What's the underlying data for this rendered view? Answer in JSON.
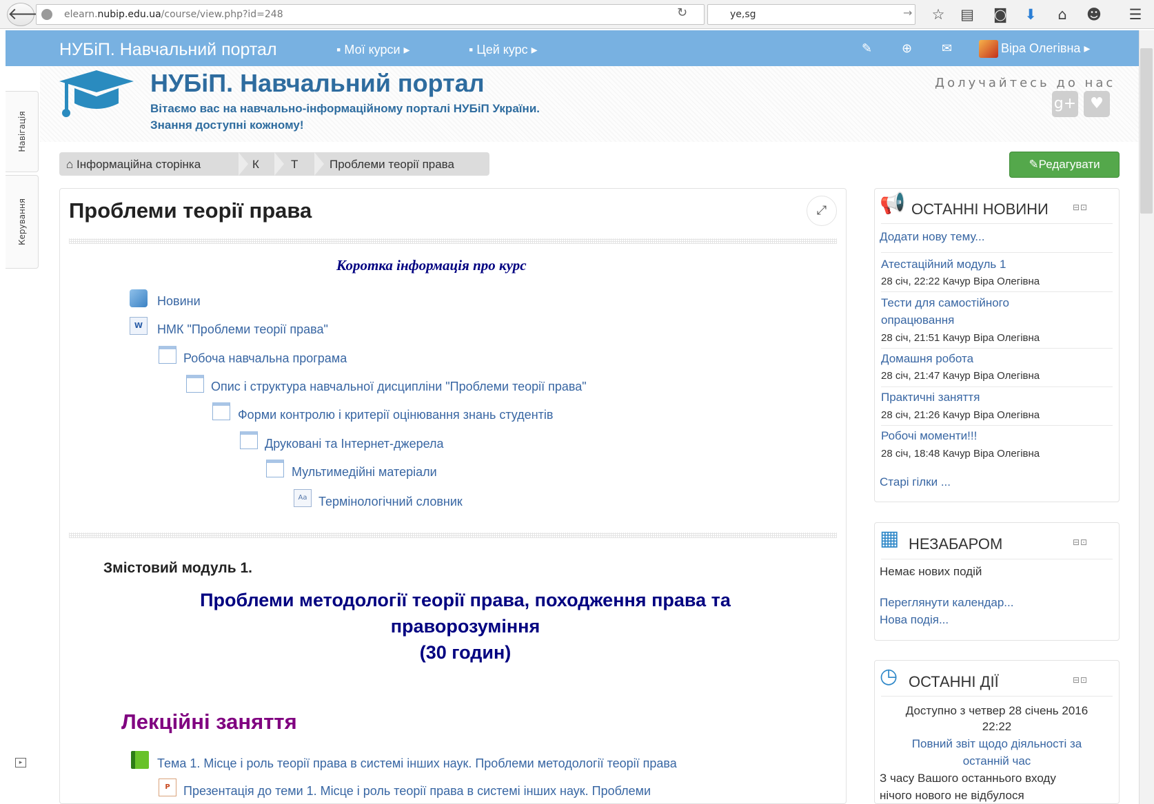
{
  "browser": {
    "url_prefix": "elearn.",
    "url_host": "nubip.edu.ua",
    "url_path": "/course/view.php?id=248",
    "search_value": "ye,sg",
    "reload_icon": "↻",
    "search_go": "→"
  },
  "navbar": {
    "brand": "НУБіП. Навчальний портал",
    "my_courses": "Мої курси",
    "this_course": "Цей курс",
    "user_name": "Віра Олегівна"
  },
  "drawers": {
    "navigation": "Навігація",
    "administration": "Керування"
  },
  "header": {
    "site_name": "НУБіП. Навчальний портал",
    "welcome_line1": "Вітаємо вас на навчально-інформаційному порталі НУБіП України.",
    "welcome_line2": "Знання доступні кожному!",
    "join_us": "Долучайтесь до нас"
  },
  "breadcrumb": {
    "home": "Інформаційна сторінка",
    "k": "К",
    "t": "Т",
    "current": "Проблеми теорії права"
  },
  "edit_button": "Редагувати",
  "course": {
    "title": "Проблеми теорії права",
    "brief_info": "Коротка інформація про курс",
    "activities": [
      {
        "label": "Новини",
        "icon": "forum-icon"
      },
      {
        "label": "НМК \"Проблеми теорії права\"",
        "icon": "word-file-icon"
      },
      {
        "label": "Робоча навчальна програма",
        "icon": "page-icon"
      },
      {
        "label": "Опис і структура навчальної дисципліни \"Проблеми теорії права\"",
        "icon": "page-icon"
      },
      {
        "label": "Форми контролю і критерії оцінювання знань студентів",
        "icon": "page-icon"
      },
      {
        "label": "Друковані та Інтернет-джерела",
        "icon": "page-icon"
      },
      {
        "label": "Мультимедійні матеріали",
        "icon": "page-icon"
      },
      {
        "label": "Термінологічний словник",
        "icon": "glossary-icon"
      }
    ],
    "module_label": "Змістовий модуль 1.",
    "module_title_line1": "Проблеми методології теорії права, походження права та",
    "module_title_line2": "праворозуміння",
    "module_title_line3": "(30 годин)",
    "lectures_heading": "Лекційні заняття",
    "topic1": "Тема 1. Місце і роль теорії права в системі інших наук. Проблеми методології теорії права",
    "topic1_presentation": "Презентація до теми 1. Місце і роль теорії права в системі інших наук. Проблеми"
  },
  "news_block": {
    "title": "ОСТАННІ НОВИНИ",
    "add_topic": "Додати нову тему...",
    "items": [
      {
        "title": "Атестаційний модуль 1",
        "meta": "28 січ, 22:22 Качур Віра Олегівна"
      },
      {
        "title_line1": "Тести для самостійного",
        "title_line2": "опрацювання",
        "meta": "28 січ, 21:51 Качур Віра Олегівна"
      },
      {
        "title": "Домашня робота",
        "meta": "28 січ, 21:47 Качур Віра Олегівна"
      },
      {
        "title": "Практичні заняття",
        "meta": "28 січ, 21:26 Качур Віра Олегівна"
      },
      {
        "title": "Робочі моменти!!!",
        "meta": "28 січ, 18:48 Качур Віра Олегівна"
      }
    ],
    "older": "Старі гілки ..."
  },
  "upcoming_block": {
    "title": "НЕЗАБАРОМ",
    "no_events": "Немає нових подій",
    "go_calendar": "Переглянути календар...",
    "new_event": "Нова подія..."
  },
  "recent_block": {
    "title": "ОСТАННІ ДІЇ",
    "since_line1": "Доступно з четвер 28 січень 2016",
    "since_line2": "22:22",
    "full_report_line1": "Повний звіт щодо діяльності за",
    "full_report_line2": "останній час",
    "nothing_line1": "З часу Вашого останнього входу",
    "nothing_line2": "нічого нового не відбулося"
  },
  "colors": {
    "navbar": "#78b1e1",
    "link": "#3866a3",
    "site_title": "#2e6c9f",
    "edit_button": "#54a84b",
    "module_title": "#000080",
    "lectures": "#800080"
  }
}
